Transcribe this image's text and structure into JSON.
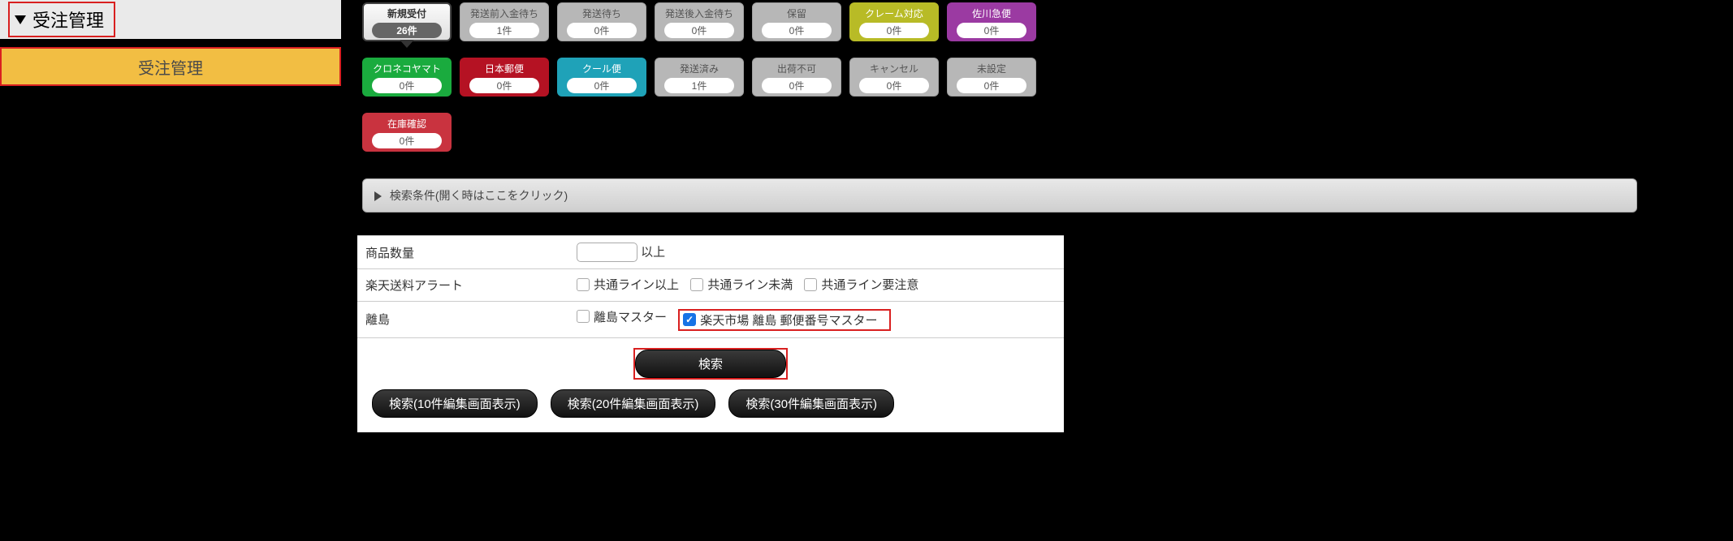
{
  "sidebar": {
    "header": "受注管理",
    "item": "受注管理"
  },
  "tabs": [
    {
      "label": "新規受付",
      "count": "26件",
      "cls": "tab-active"
    },
    {
      "label": "発送前入金待ち",
      "count": "1件",
      "cls": "tab-gray"
    },
    {
      "label": "発送待ち",
      "count": "0件",
      "cls": "tab-gray"
    },
    {
      "label": "発送後入金待ち",
      "count": "0件",
      "cls": "tab-gray"
    },
    {
      "label": "保留",
      "count": "0件",
      "cls": "tab-gray"
    },
    {
      "label": "クレーム対応",
      "count": "0件",
      "cls": "tab-olive"
    },
    {
      "label": "佐川急便",
      "count": "0件",
      "cls": "tab-purple"
    },
    {
      "label": "クロネコヤマト",
      "count": "0件",
      "cls": "tab-green"
    },
    {
      "label": "日本郵便",
      "count": "0件",
      "cls": "tab-red"
    },
    {
      "label": "クール便",
      "count": "0件",
      "cls": "tab-teal"
    },
    {
      "label": "発送済み",
      "count": "1件",
      "cls": "tab-gray"
    },
    {
      "label": "出荷不可",
      "count": "0件",
      "cls": "tab-gray"
    },
    {
      "label": "キャンセル",
      "count": "0件",
      "cls": "tab-gray"
    },
    {
      "label": "未設定",
      "count": "0件",
      "cls": "tab-gray"
    },
    {
      "label": "在庫確認",
      "count": "0件",
      "cls": "tab-red2"
    }
  ],
  "searchBar": "検索条件(開く時はここをクリック)",
  "filters": {
    "qtyLabel": "商品数量",
    "qtySuffix": "以上",
    "rakutenAlertLabel": "楽天送料アラート",
    "alerts": [
      "共通ライン以上",
      "共通ライン未満",
      "共通ライン要注意"
    ],
    "islandLabel": "離島",
    "islandMaster": "離島マスター",
    "rakutenIslandMaster": "楽天市場 離島 郵便番号マスター"
  },
  "buttons": {
    "search": "検索",
    "s10": "検索(10件編集画面表示)",
    "s20": "検索(20件編集画面表示)",
    "s30": "検索(30件編集画面表示)"
  }
}
